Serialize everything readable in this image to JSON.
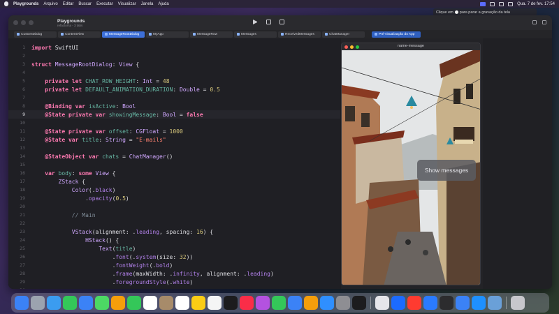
{
  "menubar": {
    "app_name": "Playgrounds",
    "menus": [
      "Arquivo",
      "Editar",
      "Buscar",
      "Executar",
      "Visualizar",
      "Janela",
      "Ajuda"
    ],
    "datetime": "Qua. 7 de fev.  17:54"
  },
  "tooltip": {
    "prefix": "Clique em",
    "suffix": "para parar a gravação da tela"
  },
  "window": {
    "project_name": "Playgrounds",
    "branch": "refactor/ui - 3 tabs"
  },
  "tabs": [
    {
      "label": "CustomDialog",
      "active": false
    },
    {
      "label": "ContentView",
      "active": false
    },
    {
      "label": "MessageRootDialog",
      "active": true
    },
    {
      "label": "MyApp",
      "active": false
    },
    {
      "label": "MessageRow",
      "active": false
    },
    {
      "label": "Messages",
      "active": false
    },
    {
      "label": "ReceivedMessages",
      "active": false
    },
    {
      "label": "ChatManager",
      "active": false
    }
  ],
  "preview_tab": {
    "label": "Pré-visualização do App"
  },
  "simulator": {
    "title": "name-message",
    "button_label": "Show messages"
  },
  "editor": {
    "current_line": 9,
    "line_numbers": [
      "1",
      "2",
      "3",
      "4",
      "5",
      "6",
      "7",
      "8",
      "9",
      "10",
      "11",
      "12",
      "13",
      "14",
      "15",
      "16",
      "17",
      "18",
      "19",
      "20",
      "21",
      "22",
      "23",
      "24",
      "25",
      "26",
      "27",
      "28",
      "29",
      "30"
    ],
    "lines": [
      "import SwiftUI",
      "",
      "struct MessageRootDialog: View {",
      "",
      "    private let CHAT_ROW_HEIGHT: Int = 48",
      "    private let DEFAULT_ANIMATION_DURATION: Double = 0.5",
      "",
      "    @Binding var isActive: Bool",
      "    @State private var showingMessage: Bool = false",
      "",
      "    @State private var offset: CGFloat = 1000",
      "    @State var title: String = \"E-mails\"",
      "",
      "    @StateObject var chats = ChatManager()",
      "",
      "    var body: some View {",
      "        ZStack {",
      "            Color(.black)",
      "                .opacity(0.5)",
      "",
      "            // Main",
      "",
      "            VStack(alignment: .leading, spacing: 16) {",
      "                HStack() {",
      "                    Text(title)",
      "                        .font(.system(size: 32))",
      "                        .fontWeight(.bold)",
      "                        .frame(maxWidth: .infinity, alignment: .leading)",
      "                        .foregroundStyle(.white)",
      ""
    ]
  },
  "dock": {
    "icons": [
      "finder-icon",
      "launchpad-icon",
      "safari-icon",
      "messages-icon",
      "mail-icon",
      "maps-icon",
      "photos-icon",
      "facetime-icon",
      "calendar-icon",
      "contacts-icon",
      "reminders-icon",
      "notes-icon",
      "freeform-icon",
      "tv-icon",
      "music-icon",
      "podcasts-icon",
      "numbers-icon",
      "keynote-icon",
      "pages-icon",
      "app-store-icon",
      "settings-icon",
      "iphone-mirroring-icon",
      "screenshot-icon",
      "testflight-icon",
      "playgrounds-icon",
      "xcode-icon",
      "terminal-icon",
      "activity-icon",
      "finder-alt-icon",
      "preview-icon",
      "trash-icon"
    ],
    "colors": [
      "#3b82f6",
      "#9ca3af",
      "#3b9cf0",
      "#34c759",
      "#3b82f6",
      "#4cd964",
      "#f59e0b",
      "#34c759",
      "#ffffff",
      "#a78b6a",
      "#ffffff",
      "#facc15",
      "#f5f5f5",
      "#1c1c1e",
      "#fa2d48",
      "#b452e0",
      "#34c759",
      "#3b82f6",
      "#f59e0b",
      "#2f8fff",
      "#8e8e93",
      "#1c1c1e",
      "#e5e5ea",
      "#1c6bff",
      "#ff3b30",
      "#2a7bff",
      "#2c2c2e",
      "#3b82f6",
      "#1e90ff",
      "#6aa0d8",
      "#c7c7cc"
    ]
  },
  "colors": {
    "accent": "#3d6fd8",
    "keyword": "#ff7ab2",
    "string": "#ff8170",
    "number": "#d9c97c"
  }
}
